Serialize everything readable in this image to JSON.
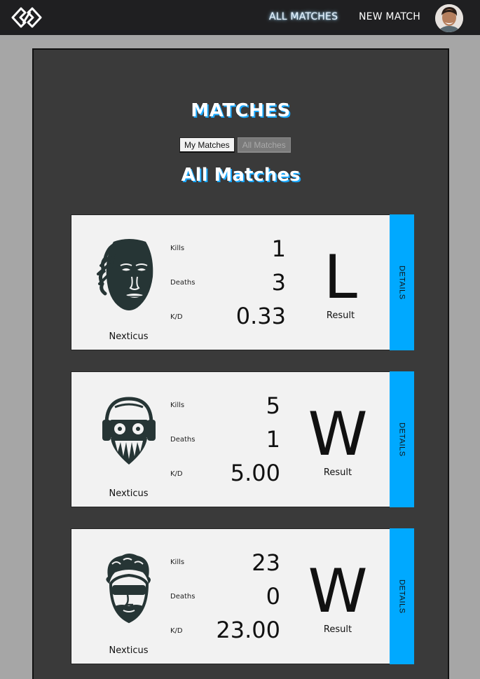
{
  "nav": {
    "links": [
      {
        "label": "ALL MATCHES",
        "active": true
      },
      {
        "label": "NEW MATCH",
        "active": false
      }
    ]
  },
  "page": {
    "title": "MATCHES",
    "filters": [
      {
        "label": "My Matches",
        "selected": true
      },
      {
        "label": "All Matches",
        "selected": false
      }
    ],
    "section_title": "All Matches"
  },
  "matches": [
    {
      "player": "Nexticus",
      "kills_label": "Kills",
      "kills": "1",
      "deaths_label": "Deaths",
      "deaths": "3",
      "kd_label": "K/D",
      "kd": "0.33",
      "result": "L",
      "result_label": "Result",
      "details_label": "DETAILS",
      "avatar_icon": "dreadlocks-face-icon"
    },
    {
      "player": "Nexticus",
      "kills_label": "Kills",
      "kills": "5",
      "deaths_label": "Deaths",
      "deaths": "1",
      "kd_label": "K/D",
      "kd": "5.00",
      "result": "W",
      "result_label": "Result",
      "details_label": "DETAILS",
      "avatar_icon": "helmet-mask-face-icon"
    },
    {
      "player": "Nexticus",
      "kills_label": "Kills",
      "kills": "23",
      "deaths_label": "Deaths",
      "deaths": "0",
      "kd_label": "K/D",
      "kd": "23.00",
      "result": "W",
      "result_label": "Result",
      "details_label": "DETAILS",
      "avatar_icon": "curly-hair-face-icon"
    }
  ],
  "colors": {
    "accent": "#00a9ff",
    "nav_bg": "#1f1f21",
    "panel_bg": "#3a3a3a",
    "page_bg": "#a6a6a6",
    "card_bg": "#f2f2f2",
    "icon": "#263535"
  }
}
